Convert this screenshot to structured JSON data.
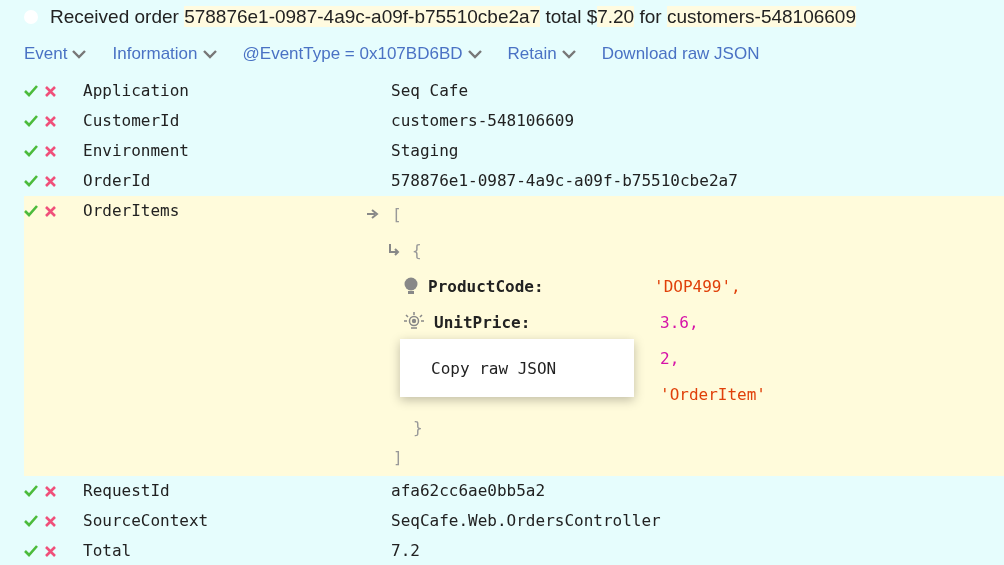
{
  "title": {
    "segments": [
      {
        "text": "Received order ",
        "highlight": false
      },
      {
        "text": "578876e1-0987-4a9c-a09f-b75510cbe2a7",
        "highlight": true
      },
      {
        "text": " total $",
        "highlight": false
      },
      {
        "text": "7.20",
        "highlight": true
      },
      {
        "text": " for ",
        "highlight": false
      },
      {
        "text": "customers-548106609",
        "highlight": true
      }
    ]
  },
  "toolbar": [
    {
      "label": "Event",
      "dropdown": true
    },
    {
      "label": "Information",
      "dropdown": true
    },
    {
      "label": "@EventType = 0x107BD6BD",
      "dropdown": true
    },
    {
      "label": "Retain",
      "dropdown": true
    },
    {
      "label": "Download raw JSON",
      "dropdown": false
    }
  ],
  "properties": [
    {
      "name": "Application",
      "value": "Seq Cafe",
      "selected": false
    },
    {
      "name": "CustomerId",
      "value": "customers-548106609",
      "selected": false
    },
    {
      "name": "Environment",
      "value": "Staging",
      "selected": false
    },
    {
      "name": "OrderId",
      "value": "578876e1-0987-4a9c-a09f-b75510cbe2a7",
      "selected": false
    },
    {
      "name": "OrderItems",
      "selected": true,
      "structure": {
        "open_array": "[",
        "open_object": "{",
        "close_object": "}",
        "close_array": "]",
        "fields": [
          {
            "kind": "bulb",
            "key": "ProductCode:",
            "value": "'DOP499',",
            "color": "#e0400a"
          },
          {
            "kind": "lit",
            "key": "UnitPrice:",
            "value": "3.6,",
            "color": "#d612a8"
          },
          {
            "kind": "plain",
            "value": "2,",
            "color": "#d612a8"
          },
          {
            "kind": "plain",
            "value": "'OrderItem'",
            "color": "#e0400a"
          }
        ]
      }
    },
    {
      "name": "RequestId",
      "value": "afa62cc6ae0bb5a2",
      "selected": false
    },
    {
      "name": "SourceContext",
      "value": "SeqCafe.Web.OrdersController",
      "selected": false
    },
    {
      "name": "Total",
      "value": "7.2",
      "selected": false
    }
  ],
  "context_menu": {
    "items": [
      "Copy raw JSON"
    ]
  }
}
